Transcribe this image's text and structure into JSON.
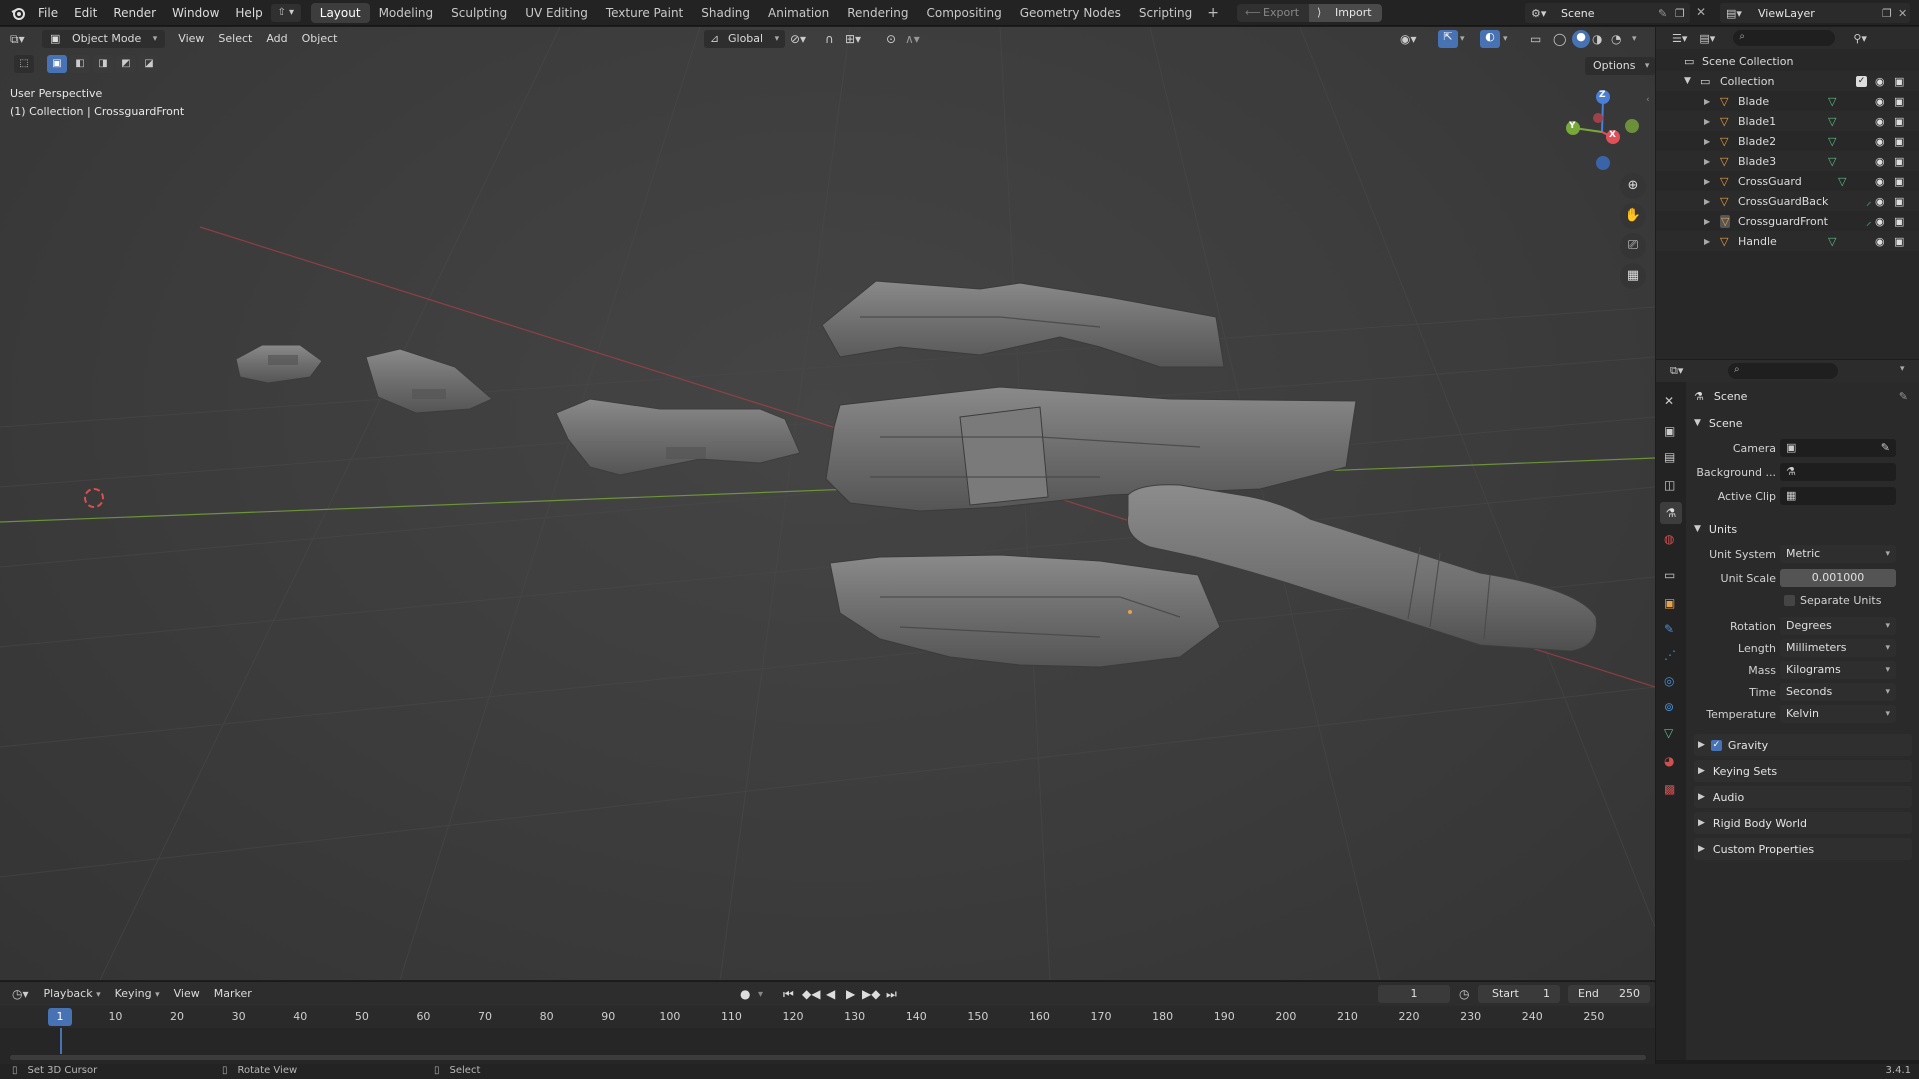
{
  "topbar": {
    "menus": [
      "File",
      "Edit",
      "Render",
      "Window",
      "Help"
    ],
    "workspace_tabs": [
      "Layout",
      "Modeling",
      "Sculpting",
      "UV Editing",
      "Texture Paint",
      "Shading",
      "Animation",
      "Rendering",
      "Compositing",
      "Geometry Nodes",
      "Scripting"
    ],
    "active_tab": "Layout",
    "add_workspace": "+",
    "export_label": "Export",
    "import_label": "Import",
    "scene_name": "Scene",
    "view_layer": "ViewLayer"
  },
  "viewport": {
    "mode": "Object Mode",
    "menus": [
      "View",
      "Select",
      "Add",
      "Object"
    ],
    "transform_orientation": "Global",
    "perspective_label": "User Perspective",
    "context_label": "(1) Collection | CrossguardFront",
    "options_label": "Options",
    "gizmo_axes": {
      "x": "X",
      "y": "Y",
      "z": "Z"
    }
  },
  "outliner": {
    "root": "Scene Collection",
    "collection": "Collection",
    "objects": [
      "Blade",
      "Blade1",
      "Blade2",
      "Blade3",
      "CrossGuard",
      "CrossGuardBack",
      "CrossguardFront",
      "Handle"
    ],
    "active_object": "CrossguardFront"
  },
  "properties": {
    "context_title": "Scene",
    "scene_panel": {
      "title": "Scene",
      "camera_label": "Camera",
      "background_label": "Background ...",
      "active_clip_label": "Active Clip"
    },
    "units_panel": {
      "title": "Units",
      "unit_system_label": "Unit System",
      "unit_system": "Metric",
      "unit_scale_label": "Unit Scale",
      "unit_scale": "0.001000",
      "separate_units": "Separate Units",
      "rotation_label": "Rotation",
      "rotation": "Degrees",
      "length_label": "Length",
      "length": "Millimeters",
      "mass_label": "Mass",
      "mass": "Kilograms",
      "time_label": "Time",
      "time": "Seconds",
      "temperature_label": "Temperature",
      "temperature": "Kelvin"
    },
    "collapsed_panels": [
      "Gravity",
      "Keying Sets",
      "Audio",
      "Rigid Body World",
      "Custom Properties"
    ],
    "gravity_enabled": true
  },
  "timeline": {
    "menus": [
      "Playback",
      "Keying",
      "View",
      "Marker"
    ],
    "current_frame": "1",
    "start_label": "Start",
    "start": "1",
    "end_label": "End",
    "end": "250",
    "ruler_marks": [
      "1",
      "10",
      "20",
      "30",
      "40",
      "50",
      "60",
      "70",
      "80",
      "90",
      "100",
      "110",
      "120",
      "130",
      "140",
      "150",
      "160",
      "170",
      "180",
      "190",
      "200",
      "210",
      "220",
      "230",
      "240",
      "250"
    ]
  },
  "statusbar": {
    "hint_left": "Set 3D Cursor",
    "hint_middle": "Rotate View",
    "hint_right": "Select",
    "version": "3.4.1"
  },
  "colors": {
    "accent_blue": "#4772b3",
    "axis_x": "#e0505a",
    "axis_y": "#78a83a",
    "axis_z": "#4a7fd6",
    "object_orange": "#e8a24a",
    "mesh_green": "#5fbf8a"
  }
}
